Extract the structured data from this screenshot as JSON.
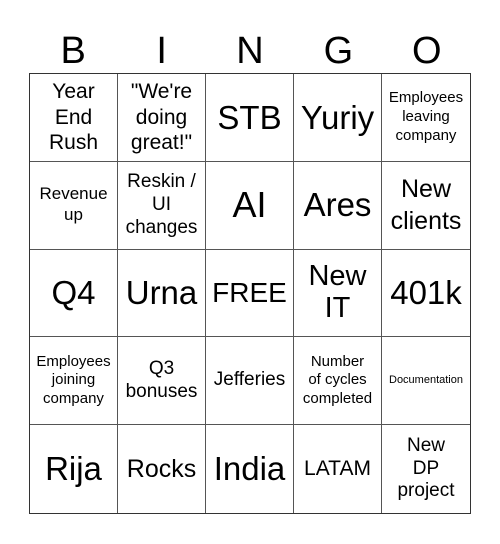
{
  "header": [
    "B",
    "I",
    "N",
    "G",
    "O"
  ],
  "cells": [
    {
      "text": "Year\nEnd\nRush",
      "size": "s21"
    },
    {
      "text": "\"We're\ndoing\ngreat!\"",
      "size": "s21"
    },
    {
      "text": "STB",
      "size": "s33"
    },
    {
      "text": "Yuriy",
      "size": "s33"
    },
    {
      "text": "Employees\nleaving\ncompany",
      "size": "s15"
    },
    {
      "text": "Revenue\nup",
      "size": "s17"
    },
    {
      "text": "Reskin /\nUI\nchanges",
      "size": "s19"
    },
    {
      "text": "AI",
      "size": "s36"
    },
    {
      "text": "Ares",
      "size": "s33"
    },
    {
      "text": "New\nclients",
      "size": "s25"
    },
    {
      "text": "Q4",
      "size": "s33"
    },
    {
      "text": "Urna",
      "size": "s33"
    },
    {
      "text": "FREE",
      "size": "s28"
    },
    {
      "text": "New\nIT",
      "size": "s29"
    },
    {
      "text": "401k",
      "size": "s33"
    },
    {
      "text": "Employees\njoining\ncompany",
      "size": "s15"
    },
    {
      "text": "Q3\nbonuses",
      "size": "s19"
    },
    {
      "text": "Jefferies",
      "size": "s19"
    },
    {
      "text": "Number\nof cycles\ncompleted",
      "size": "s15"
    },
    {
      "text": "Documentation",
      "size": "s11"
    },
    {
      "text": "Rija",
      "size": "s33"
    },
    {
      "text": "Rocks",
      "size": "s25"
    },
    {
      "text": "India",
      "size": "s33"
    },
    {
      "text": "LATAM",
      "size": "s21"
    },
    {
      "text": "New\nDP\nproject",
      "size": "s19"
    }
  ]
}
